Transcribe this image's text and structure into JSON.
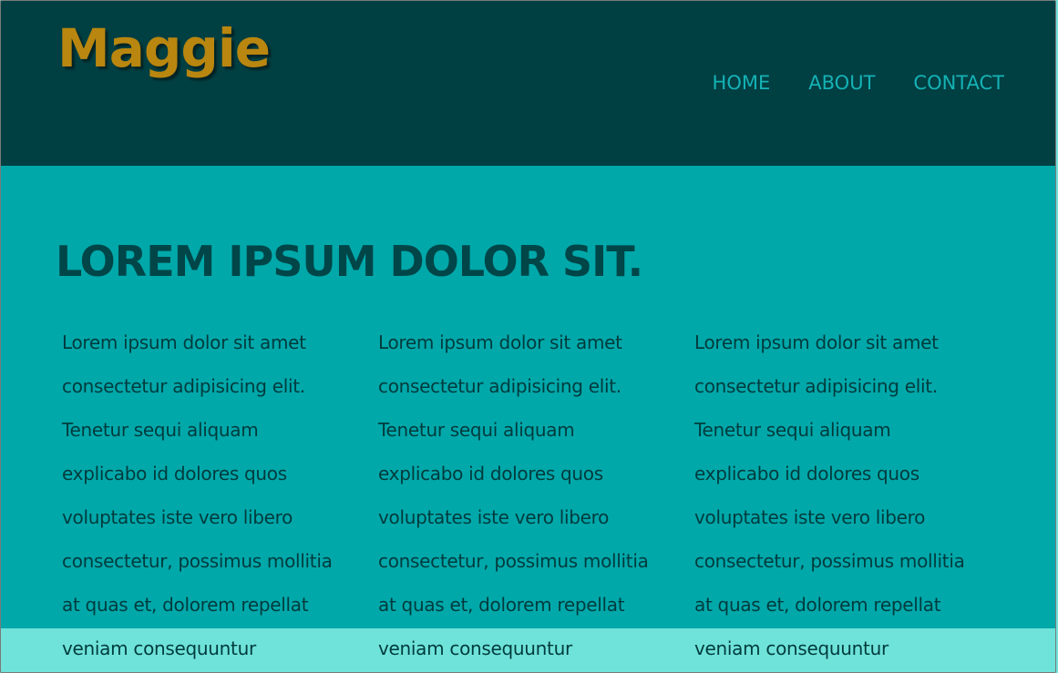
{
  "site": {
    "logo": "Maggie"
  },
  "nav": {
    "items": [
      {
        "label": "HOME"
      },
      {
        "label": "ABOUT"
      },
      {
        "label": "CONTACT"
      }
    ]
  },
  "main": {
    "headline": "LOREM IPSUM DOLOR SIT.",
    "columns": [
      {
        "text": "Lorem ipsum dolor sit amet\nconsectetur adipisicing elit.\nTenetur sequi aliquam\nexplicabo id dolores quos\nvoluptates iste vero libero\nconsectetur, possimus mollitia\nat quas et, dolorem repellat\nveniam consequuntur"
      },
      {
        "text": "Lorem ipsum dolor sit amet\nconsectetur adipisicing elit.\nTenetur sequi aliquam\nexplicabo id dolores quos\nvoluptates iste vero libero\nconsectetur, possimus mollitia\nat quas et, dolorem repellat\nveniam consequuntur"
      },
      {
        "text": "Lorem ipsum dolor sit amet\nconsectetur adipisicing elit.\nTenetur sequi aliquam\nexplicabo id dolores quos\nvoluptates iste vero libero\nconsectetur, possimus mollitia\nat quas et, dolorem repellat\nveniam consequuntur"
      }
    ]
  },
  "colors": {
    "header_bg": "#003f42",
    "main_bg": "#00a8aa",
    "footer_bg": "#6fe3d9",
    "logo": "#b9860f",
    "nav_link": "#15b2b5",
    "headline": "#004648"
  }
}
